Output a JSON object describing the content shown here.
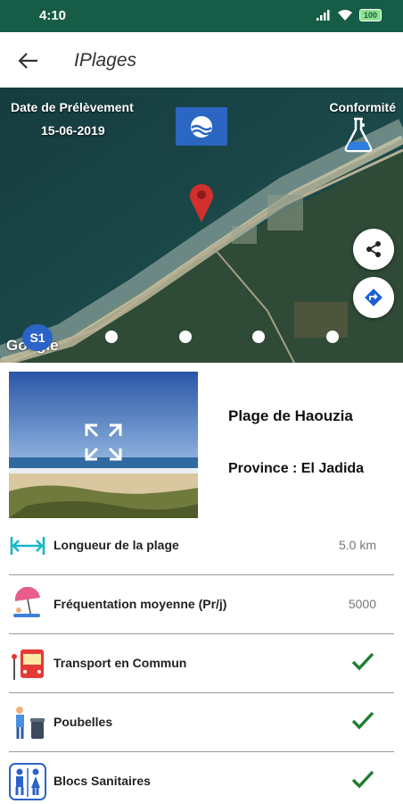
{
  "status_bar": {
    "time": "4:10",
    "battery": "100"
  },
  "app_bar": {
    "title": "IPlages"
  },
  "map": {
    "date_label": "Date de Prélèvement",
    "date_value": "15-06-2019",
    "conformity_label": "Conformité",
    "station_badge": "S1",
    "attribution": "Google",
    "carousel_dots": 4
  },
  "beach": {
    "name": "Plage de Haouzia",
    "province": "Province : El Jadida"
  },
  "facilities": [
    {
      "label": "Longueur de la plage",
      "value": "5.0 km",
      "icon": "ruler-icon"
    },
    {
      "label": "Fréquentation moyenne (Pr/j)",
      "value": "5000",
      "icon": "beach-umbrella-icon"
    },
    {
      "label": "Transport en Commun",
      "available": true,
      "icon": "bus-icon"
    },
    {
      "label": "Poubelles",
      "available": true,
      "icon": "trash-bin-icon"
    },
    {
      "label": "Blocs Sanitaires",
      "available": true,
      "icon": "toilets-icon"
    }
  ],
  "colors": {
    "status_bar": "#175c47",
    "check": "#1e7e34",
    "accent_blue": "#2c63c8",
    "ruler": "#19b7c9"
  }
}
